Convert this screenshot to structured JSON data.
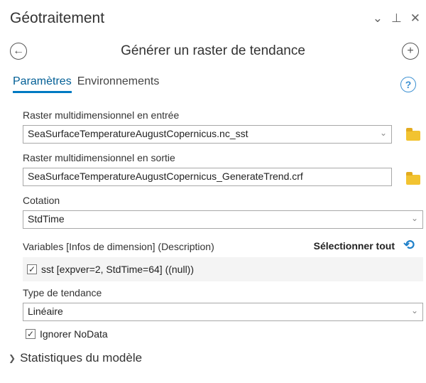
{
  "pane": {
    "title": "Géotraitement",
    "controls": {
      "collapse": "⌄",
      "pin": "⊥",
      "close": "✕"
    }
  },
  "tool": {
    "title": "Générer un raster de tendance",
    "back_icon": "arrow-left-icon",
    "add_icon": "plus-icon"
  },
  "tabs": [
    {
      "label": "Paramètres",
      "active": true
    },
    {
      "label": "Environnements",
      "active": false
    }
  ],
  "help": "?",
  "params": {
    "input_raster": {
      "label": "Raster multidimensionnel en entrée",
      "value": "SeaSurfaceTemperatureAugustCopernicus.nc_sst"
    },
    "output_raster": {
      "label": "Raster multidimensionnel en sortie",
      "value": "SeaSurfaceTemperatureAugustCopernicus_GenerateTrend.crf"
    },
    "dimension": {
      "label": "Cotation",
      "value": "StdTime"
    },
    "variables": {
      "label": "Variables [Infos de dimension] (Description)",
      "select_all": "Sélectionner tout",
      "items": [
        {
          "label": "sst [expver=2, StdTime=64] ((null))",
          "checked": true
        }
      ]
    },
    "trend_type": {
      "label": "Type de tendance",
      "value": "Linéaire"
    },
    "ignore_nodata": {
      "label": "Ignorer NoData",
      "checked": true
    }
  },
  "model_statistics": {
    "label": "Statistiques du modèle"
  },
  "colors": {
    "accent": "#007ac2",
    "folder": "#f2c331"
  }
}
